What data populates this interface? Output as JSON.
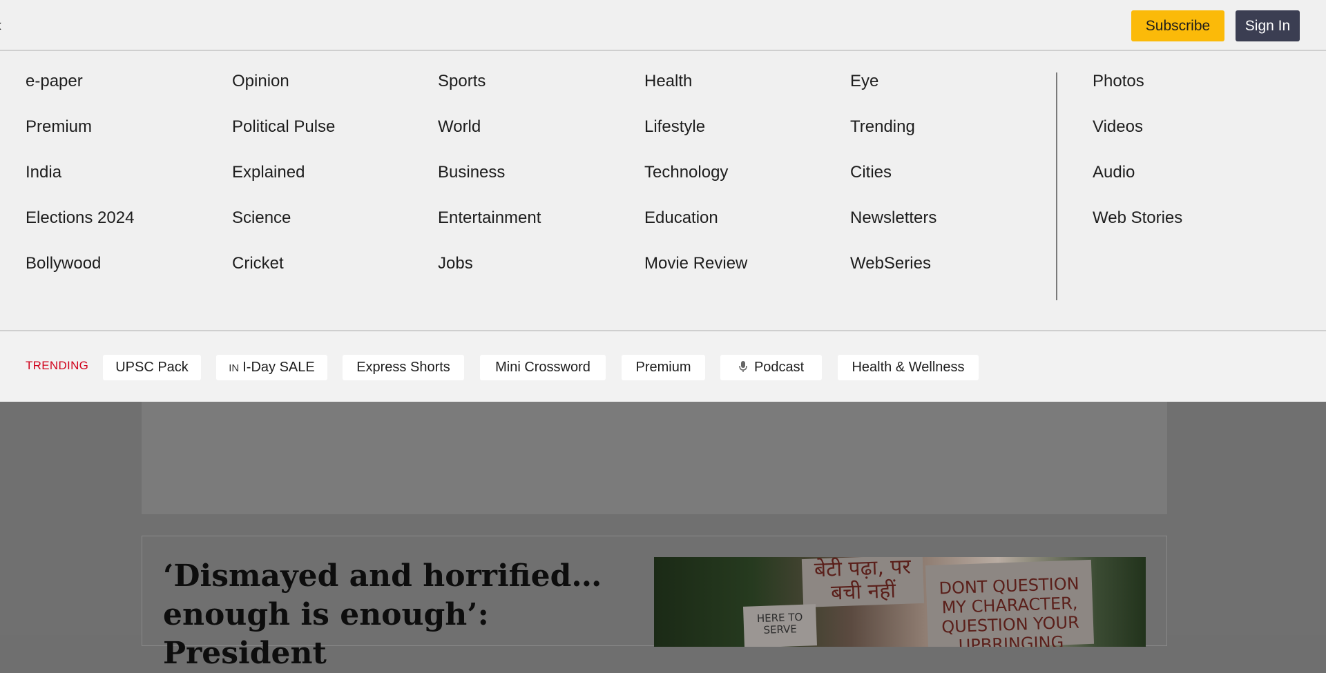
{
  "header": {
    "subscribe_label": "Subscribe",
    "signin_label": "Sign In"
  },
  "menu": {
    "columns": [
      [
        "e-paper",
        "Premium",
        "India",
        "Elections 2024",
        "Bollywood"
      ],
      [
        "Opinion",
        "Political Pulse",
        "Explained",
        "Science",
        "Cricket"
      ],
      [
        "Sports",
        "World",
        "Business",
        "Entertainment",
        "Jobs"
      ],
      [
        "Health",
        "Lifestyle",
        "Technology",
        "Education",
        "Movie Review"
      ],
      [
        "Eye",
        "Trending",
        "Cities",
        "Newsletters",
        "WebSeries"
      ],
      [
        "Photos",
        "Videos",
        "Audio",
        "Web Stories"
      ]
    ]
  },
  "trending": {
    "label": "TRENDING",
    "chips": [
      {
        "label": "UPSC Pack"
      },
      {
        "label": "I-Day SALE",
        "icon_text": "IN",
        "icon": "india-flag-icon"
      },
      {
        "label": "Express Shorts"
      },
      {
        "label": "Mini Crossword"
      },
      {
        "label": "Premium"
      },
      {
        "label": "Podcast",
        "icon": "microphone-icon"
      },
      {
        "label": "Health & Wellness"
      }
    ]
  },
  "story": {
    "headline": "‘Dismayed and horrified… enough is enough’: President",
    "placards": [
      "बेटी पढ़ा, पर बची नहीं",
      "DONT QUESTION MY CHARACTER, QUESTION YOUR UPBRINGING",
      "HERE TO SERVE"
    ]
  },
  "colors": {
    "subscribe_bg": "#fbba09",
    "signin_bg": "#3b3e52",
    "trending_label": "#d0021b",
    "overlay_bg": "#f0f0f0",
    "page_dim": "#707070"
  }
}
